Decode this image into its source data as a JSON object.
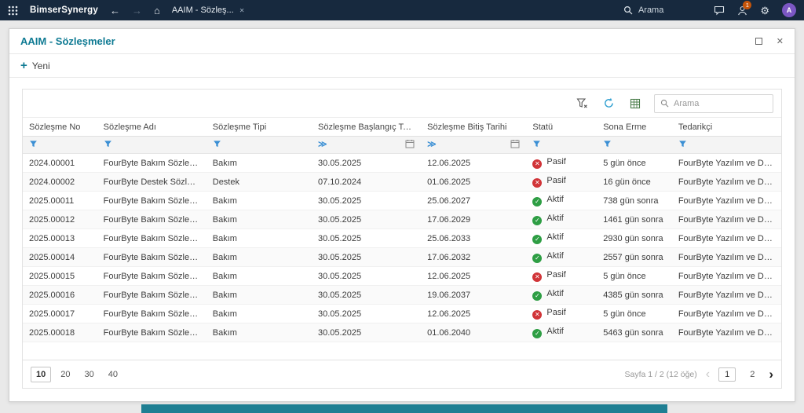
{
  "colors": {
    "accent": "#0e7a93",
    "topbar_bg": "#17293e",
    "active": "#2e9e44",
    "inactive": "#d13438",
    "filter_icon": "#3b8fd4",
    "avatar_bg": "#7b57c4",
    "badge_bg": "#c4540a",
    "bottom_strip": "#1f7f93"
  },
  "icons": {
    "back": "←",
    "forward": "→",
    "home": "⌂",
    "tab_close": "✕",
    "gear": "⚙",
    "close": "✕",
    "plus": "+",
    "date_operator": "≫",
    "check": "✓",
    "cross": "✕",
    "pager_prev": "‹",
    "pager_next": "›"
  },
  "topbar": {
    "brand": "BimserSynergy",
    "tab_label": "AAIM - Sözleş...",
    "search_label": "Arama",
    "notification_count": "1",
    "avatar_initial": "A"
  },
  "window": {
    "title": "AAIM - Sözleşmeler",
    "new_button_label": "Yeni"
  },
  "grid": {
    "search_placeholder": "Arama",
    "columns": [
      "Sözleşme No",
      "Sözleşme Adı",
      "Sözleşme Tipi",
      "Sözleşme Başlangıç Tarihi",
      "Sözleşme Bitiş Tarihi",
      "Statü",
      "Sona Erme",
      "Tedarikçi"
    ],
    "rows": [
      {
        "no": "2024.00001",
        "name": "FourByte Bakım Sözleşmesi",
        "type": "Bakım",
        "start": "30.05.2025",
        "end": "12.06.2025",
        "status": "Pasif",
        "status_kind": "inactive",
        "expiry": "5 gün önce",
        "supplier": "FourByte Yazılım ve Danışmanlık LTD. ..."
      },
      {
        "no": "2024.00002",
        "name": "FourByte Destek Sözleşmesi",
        "type": "Destek",
        "start": "07.10.2024",
        "end": "01.06.2025",
        "status": "Pasif",
        "status_kind": "inactive",
        "expiry": "16 gün önce",
        "supplier": "FourByte Yazılım ve Danışmanlık LTD. ..."
      },
      {
        "no": "2025.00011",
        "name": "FourByte Bakım Sözleşmesi",
        "type": "Bakım",
        "start": "30.05.2025",
        "end": "25.06.2027",
        "status": "Aktif",
        "status_kind": "active",
        "expiry": "738 gün sonra",
        "supplier": "FourByte Yazılım ve Danışmanlık LTD. ..."
      },
      {
        "no": "2025.00012",
        "name": "FourByte Bakım Sözleşmesi",
        "type": "Bakım",
        "start": "30.05.2025",
        "end": "17.06.2029",
        "status": "Aktif",
        "status_kind": "active",
        "expiry": "1461 gün sonra",
        "supplier": "FourByte Yazılım ve Danışmanlık LTD. ..."
      },
      {
        "no": "2025.00013",
        "name": "FourByte Bakım Sözleşmesi",
        "type": "Bakım",
        "start": "30.05.2025",
        "end": "25.06.2033",
        "status": "Aktif",
        "status_kind": "active",
        "expiry": "2930 gün sonra",
        "supplier": "FourByte Yazılım ve Danışmanlık LTD. ..."
      },
      {
        "no": "2025.00014",
        "name": "FourByte Bakım Sözleşmesi",
        "type": "Bakım",
        "start": "30.05.2025",
        "end": "17.06.2032",
        "status": "Aktif",
        "status_kind": "active",
        "expiry": "2557 gün sonra",
        "supplier": "FourByte Yazılım ve Danışmanlık LTD. ..."
      },
      {
        "no": "2025.00015",
        "name": "FourByte Bakım Sözleşmesi",
        "type": "Bakım",
        "start": "30.05.2025",
        "end": "12.06.2025",
        "status": "Pasif",
        "status_kind": "inactive",
        "expiry": "5 gün önce",
        "supplier": "FourByte Yazılım ve Danışmanlık LTD. ..."
      },
      {
        "no": "2025.00016",
        "name": "FourByte Bakım Sözleşmesi",
        "type": "Bakım",
        "start": "30.05.2025",
        "end": "19.06.2037",
        "status": "Aktif",
        "status_kind": "active",
        "expiry": "4385 gün sonra",
        "supplier": "FourByte Yazılım ve Danışmanlık LTD. ..."
      },
      {
        "no": "2025.00017",
        "name": "FourByte Bakım Sözleşmesi",
        "type": "Bakım",
        "start": "30.05.2025",
        "end": "12.06.2025",
        "status": "Pasif",
        "status_kind": "inactive",
        "expiry": "5 gün önce",
        "supplier": "FourByte Yazılım ve Danışmanlık LTD. ..."
      },
      {
        "no": "2025.00018",
        "name": "FourByte Bakım Sözleşmesi",
        "type": "Bakım",
        "start": "30.05.2025",
        "end": "01.06.2040",
        "status": "Aktif",
        "status_kind": "active",
        "expiry": "5463 gün sonra",
        "supplier": "FourByte Yazılım ve Danışmanlık LTD. ..."
      }
    ],
    "pagination": {
      "page_sizes": [
        "10",
        "20",
        "30",
        "40"
      ],
      "active_size": "10",
      "info": "Sayfa 1 / 2 (12 öğe)",
      "pages": [
        "1",
        "2"
      ],
      "active_page": "1"
    }
  }
}
